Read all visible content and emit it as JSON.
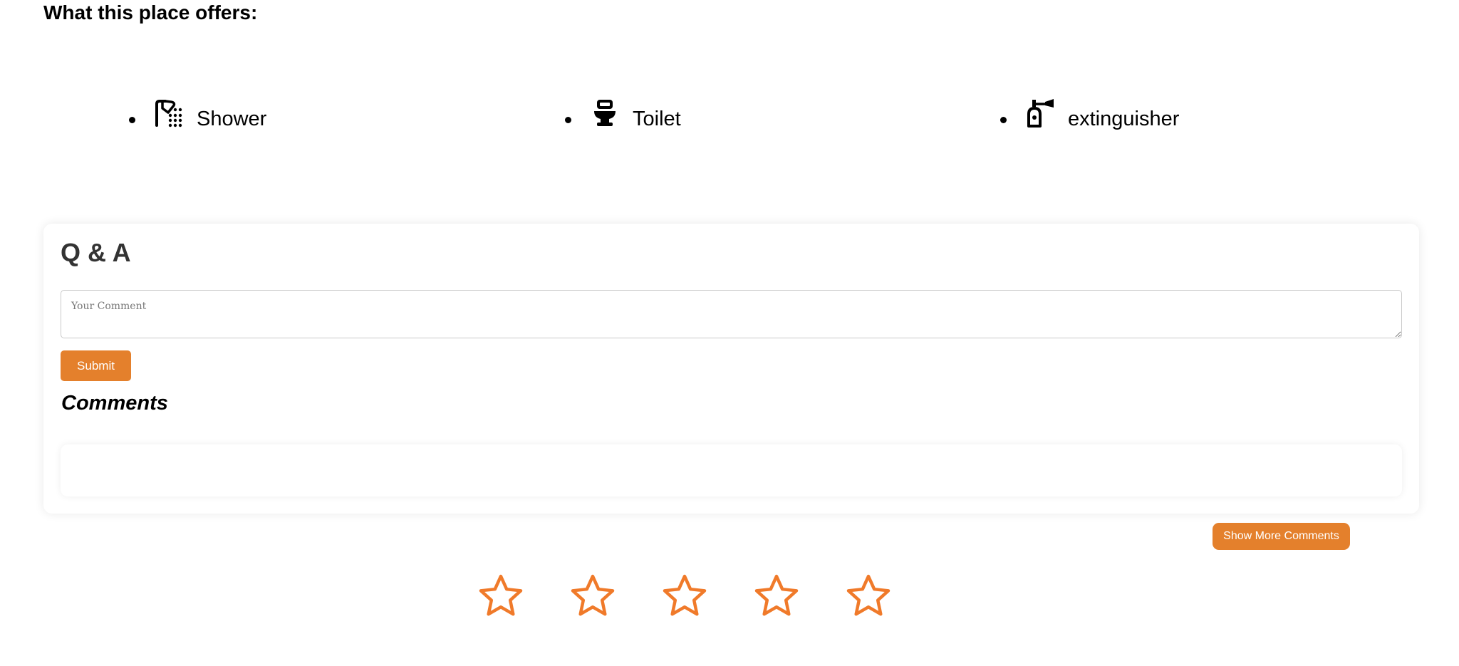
{
  "offers": {
    "title": "What this place offers:",
    "items": [
      {
        "label": "Shower",
        "icon": "shower-icon"
      },
      {
        "label": "Toilet",
        "icon": "toilet-icon"
      },
      {
        "label": "extinguisher",
        "icon": "fire-extinguisher-icon"
      }
    ]
  },
  "qa": {
    "title": "Q & A",
    "comment_placeholder": "Your Comment",
    "submit_label": "Submit",
    "comments_title": "Comments"
  },
  "show_more_label": "Show More Comments",
  "rating": {
    "max_stars": 5,
    "value": 0,
    "star_color": "#f07a2a"
  },
  "colors": {
    "accent": "#e4802c"
  }
}
